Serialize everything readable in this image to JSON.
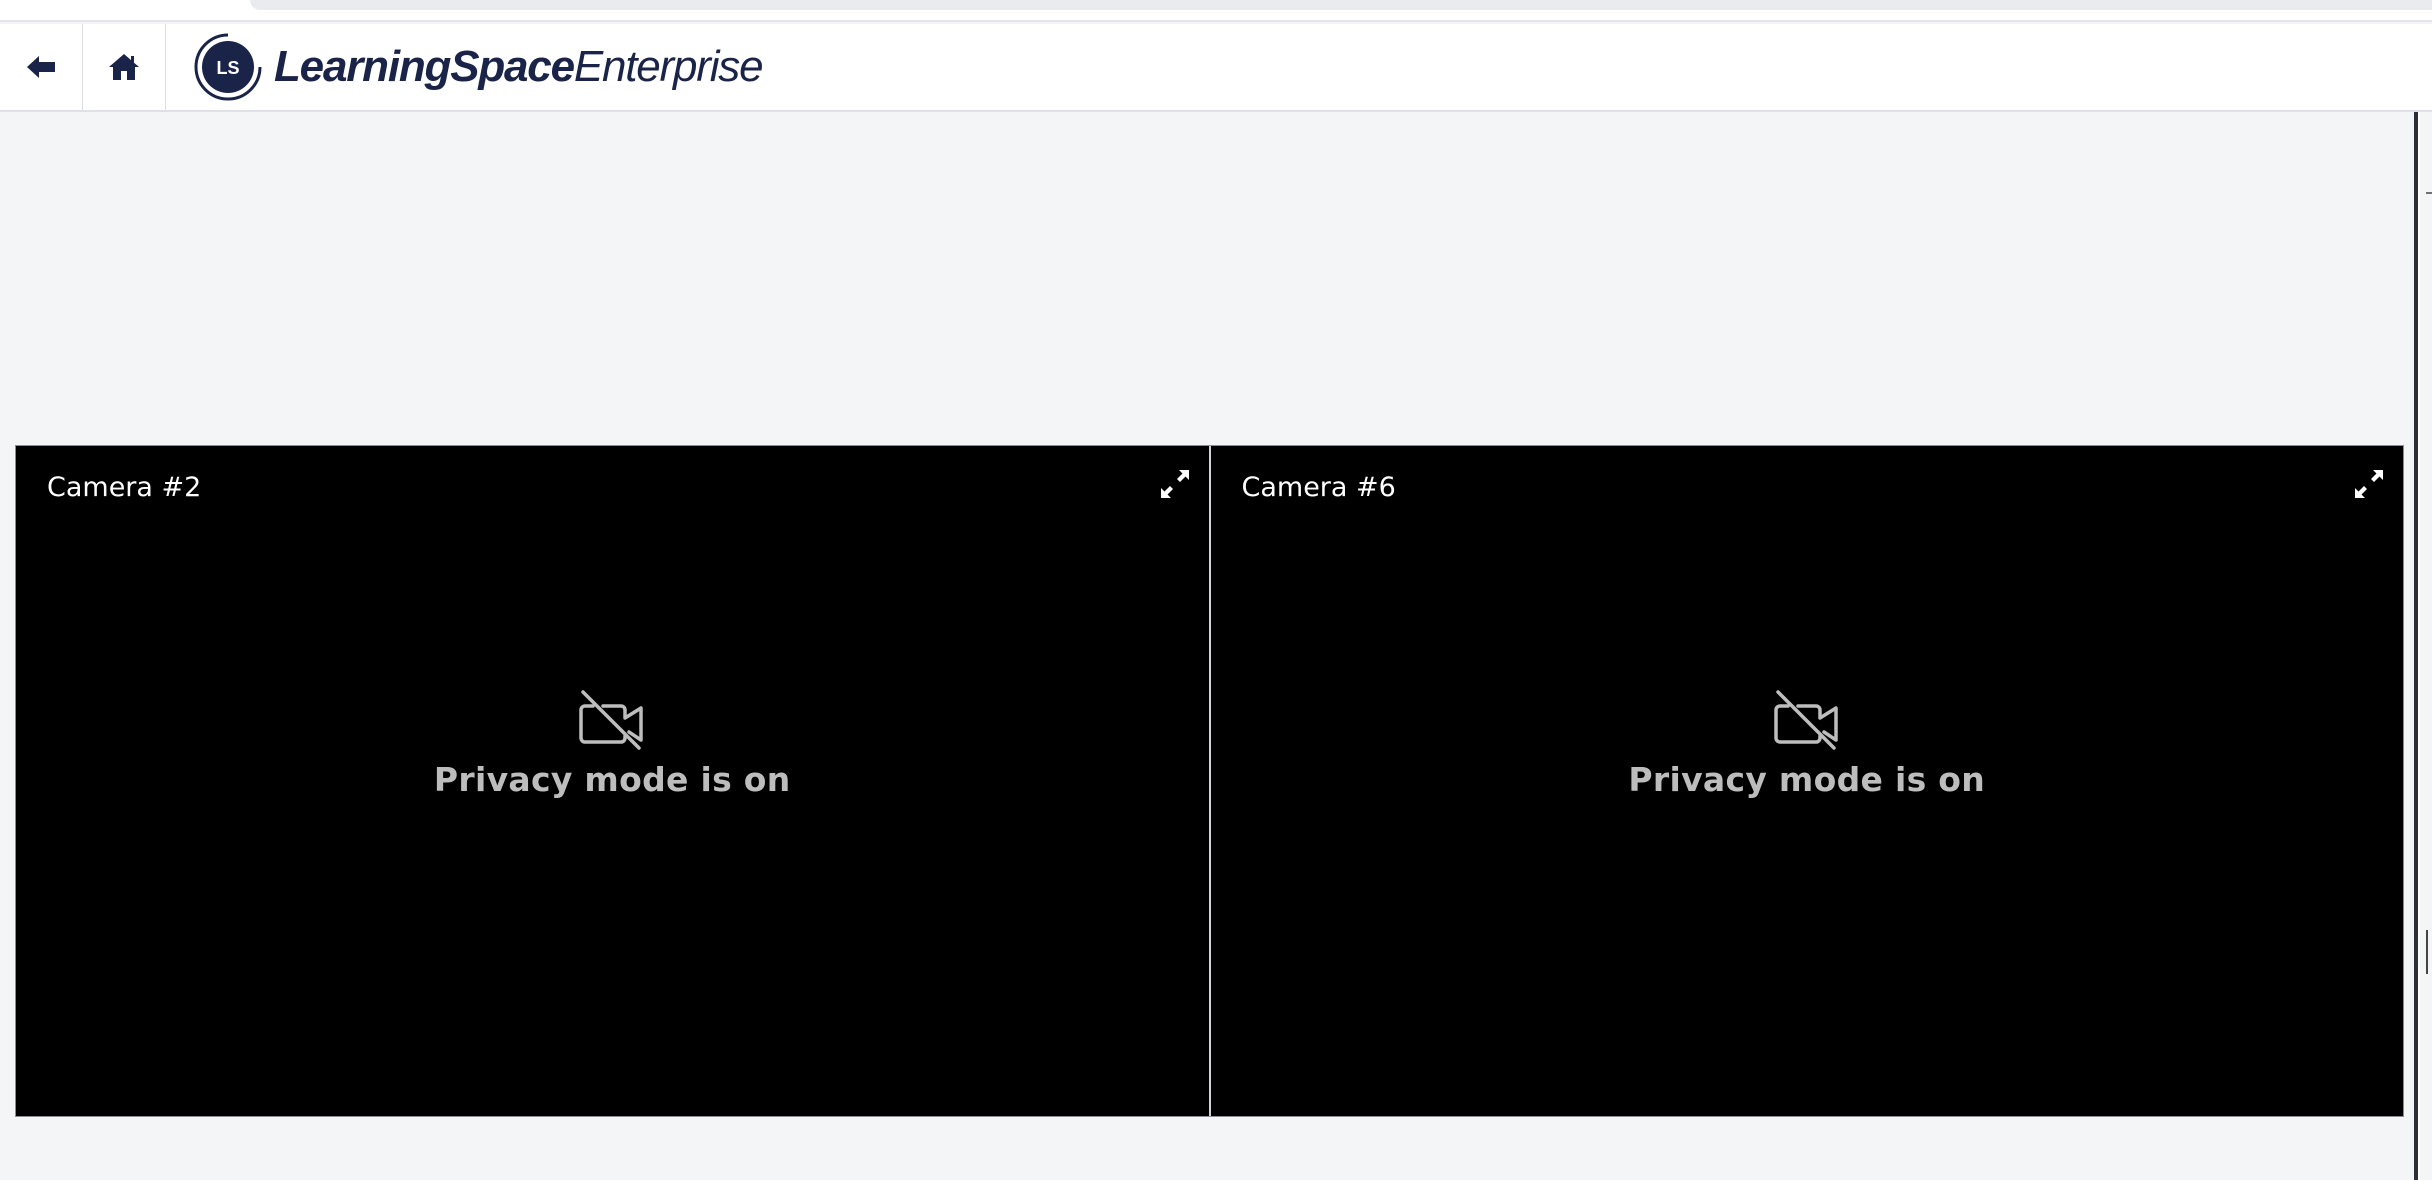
{
  "header": {
    "back_icon": "arrow-left-icon",
    "home_icon": "home-icon",
    "logo_initials": "LS",
    "brand_bold": "LearningSpace",
    "brand_light": "Enterprise",
    "brand_color": "#1a2448"
  },
  "cameras": [
    {
      "label": "Camera #2",
      "status": "Privacy mode is on",
      "status_icon": "camera-off-icon",
      "expand_icon": "expand-icon"
    },
    {
      "label": "Camera #6",
      "status": "Privacy mode is on",
      "status_icon": "camera-off-icon",
      "expand_icon": "expand-icon"
    }
  ]
}
